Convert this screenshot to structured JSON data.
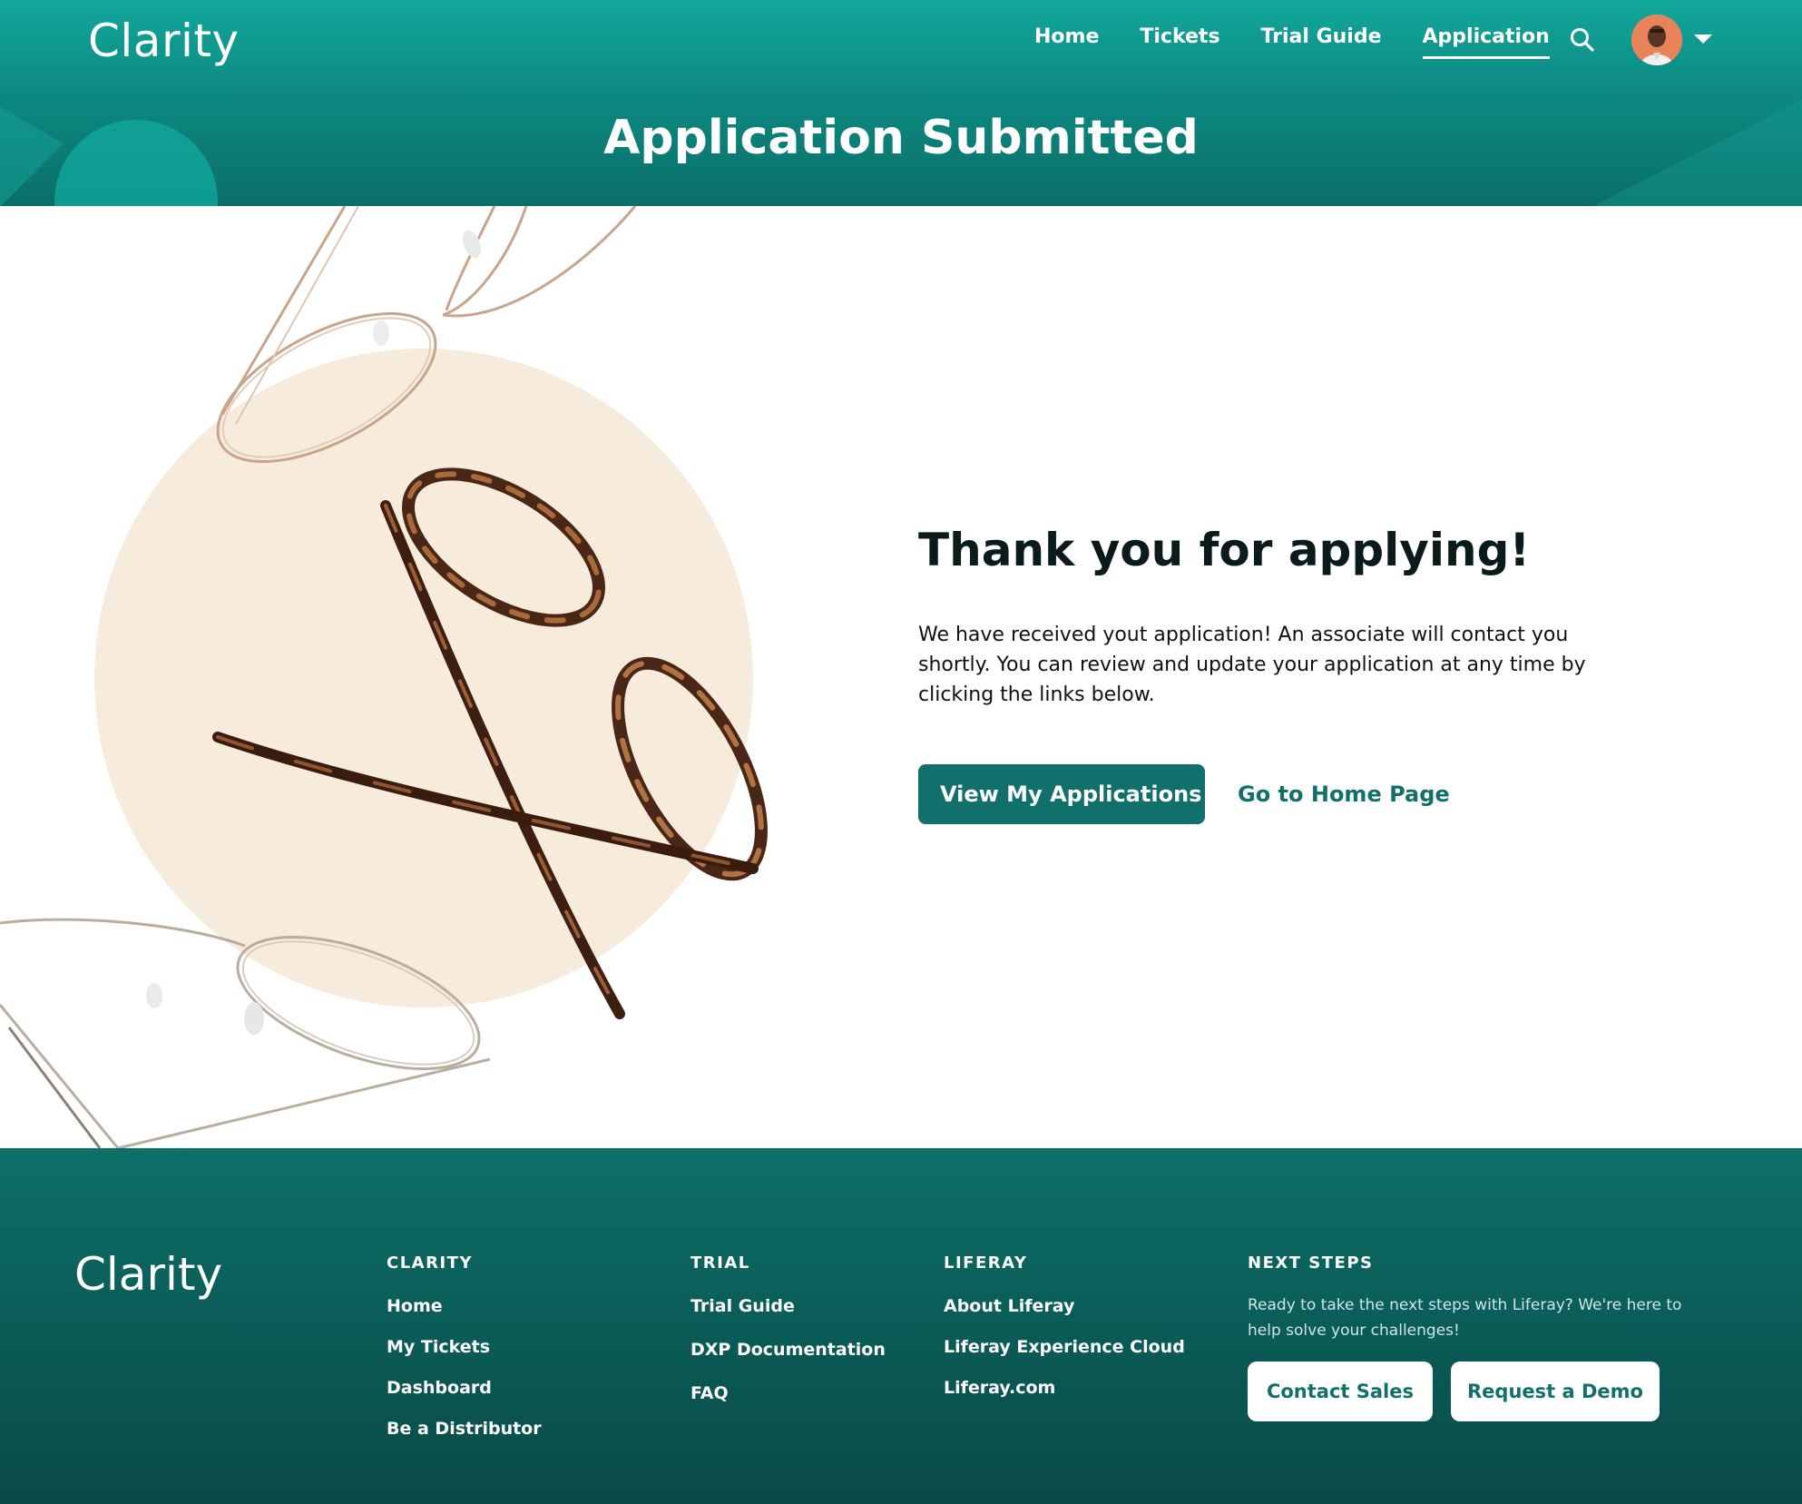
{
  "header": {
    "brand": "Clarity",
    "nav": [
      {
        "label": "Home",
        "active": false
      },
      {
        "label": "Tickets",
        "active": false
      },
      {
        "label": "Trial Guide",
        "active": false
      },
      {
        "label": "Application",
        "active": true
      }
    ],
    "search_icon": "search-icon",
    "avatar_icon": "user-avatar",
    "caret_icon": "chevron-down-icon",
    "page_title": "Application Submitted"
  },
  "main": {
    "heading": "Thank you for applying!",
    "body": "We have received yout application! An associate will contact you shortly. You can review and update your application at any time by clicking the links below.",
    "primary_button": "View My Applications",
    "secondary_link": "Go to Home Page"
  },
  "footer": {
    "brand": "Clarity",
    "columns": [
      {
        "title": "CLARITY",
        "links": [
          "Home",
          "My Tickets",
          "Dashboard",
          "Be a Distributor"
        ]
      },
      {
        "title": "TRIAL",
        "links": [
          "Trial Guide",
          "DXP Documentation",
          "FAQ"
        ]
      },
      {
        "title": "LIFERAY",
        "links": [
          "About Liferay",
          "Liferay Experience Cloud",
          "Liferay.com"
        ]
      }
    ],
    "next_steps": {
      "title": "NEXT STEPS",
      "text": "Ready to take the next steps with Liferay? We're here to help solve your challenges!",
      "buttons": [
        "Contact Sales",
        "Request a Demo"
      ]
    }
  },
  "colors": {
    "brand_teal": "#12706c",
    "header_teal": "#0d8a82",
    "footer_teal": "#0a5a56",
    "circle_beige": "#f7ebdc"
  }
}
